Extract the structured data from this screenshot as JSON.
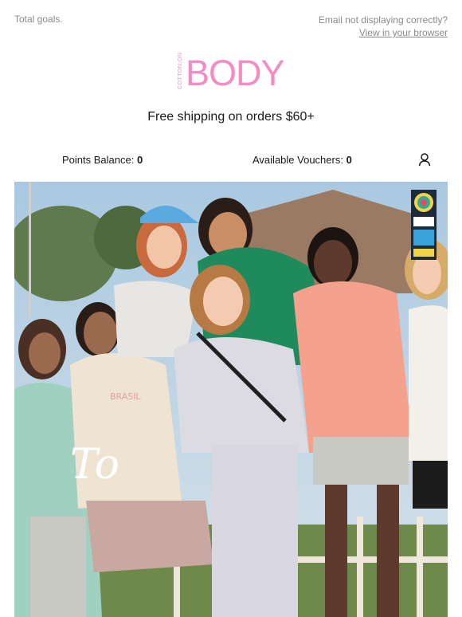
{
  "header": {
    "preheader_text": "Total goals.",
    "email_notice": "Email not displaying correctly?",
    "view_browser_link": "View in your browser"
  },
  "brand": {
    "logo_sub": "COTTON:ON",
    "logo_main": "BODY",
    "color": "#f28dc4"
  },
  "promo": {
    "shipping_text": "Free shipping on orders $60+"
  },
  "account": {
    "points_label": "Points Balance:",
    "points_value": "0",
    "vouchers_label": "Available Vouchers:",
    "vouchers_value": "0",
    "account_icon": "user-icon"
  },
  "hero": {
    "overlay_text": "To",
    "badge_icon": "fifa-womens-world-cup-badge"
  }
}
